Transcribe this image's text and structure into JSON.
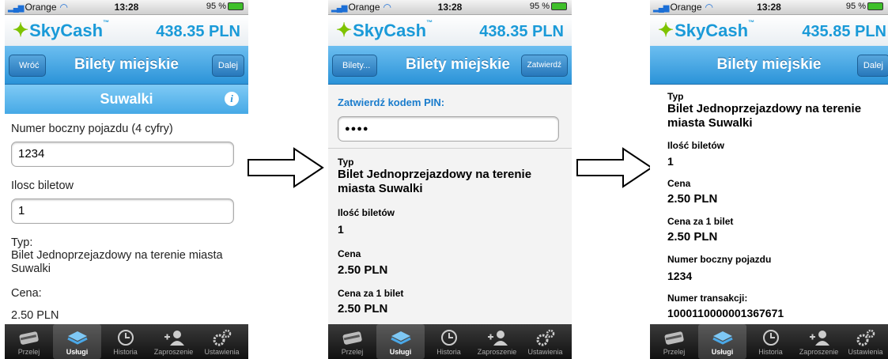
{
  "status": {
    "carrier": "Orange",
    "time": "13:28",
    "battery": "95 %"
  },
  "brand": {
    "logo": "SkyCash",
    "tm": "™"
  },
  "tabs": [
    "Przelej",
    "Usługi",
    "Historia",
    "Zaproszenie",
    "Ustawienia"
  ],
  "screen1": {
    "balance": "438.35 PLN",
    "back": "Wróć",
    "title": "Bilety miejskie",
    "right": "Dalej",
    "subtitle": "Suwalki",
    "vehicle_label": "Numer boczny pojazdu (4 cyfry)",
    "vehicle_value": "1234",
    "tickets_label": "Ilosc biletow",
    "tickets_value": "1",
    "type_label": "Typ:",
    "type_value": "Bilet Jednoprzejazdowy na terenie miasta Suwalki",
    "price_label": "Cena:",
    "price_value": "2.50 PLN"
  },
  "screen2": {
    "balance": "438.35 PLN",
    "back": "Bilety...",
    "title": "Bilety miejskie",
    "right": "Zatwierdź",
    "pin_label": "Zatwierdź kodem PIN:",
    "pin_value": "●●●●",
    "type_label": "Typ",
    "type_value": "Bilet Jednoprzejazdowy na terenie miasta Suwalki",
    "qty_label": "Ilość biletów",
    "qty_value": "1",
    "price_label": "Cena",
    "price_value": "2.50 PLN",
    "unit_label": "Cena za 1 bilet",
    "unit_value": "2.50 PLN"
  },
  "screen3": {
    "balance": "435.85 PLN",
    "title": "Bilety miejskie",
    "right": "Dalej",
    "type_label": "Typ",
    "type_value": "Bilet Jednoprzejazdowy na terenie miasta Suwalki",
    "qty_label": "Ilość biletów",
    "qty_value": "1",
    "price_label": "Cena",
    "price_value": "2.50 PLN",
    "unit_label": "Cena za 1 bilet",
    "unit_value": "2.50 PLN",
    "vehicle_label": "Numer boczny pojazdu",
    "vehicle_value": "1234",
    "txn_label": "Numer transakcji:",
    "txn_value": "1000110000001367671"
  }
}
